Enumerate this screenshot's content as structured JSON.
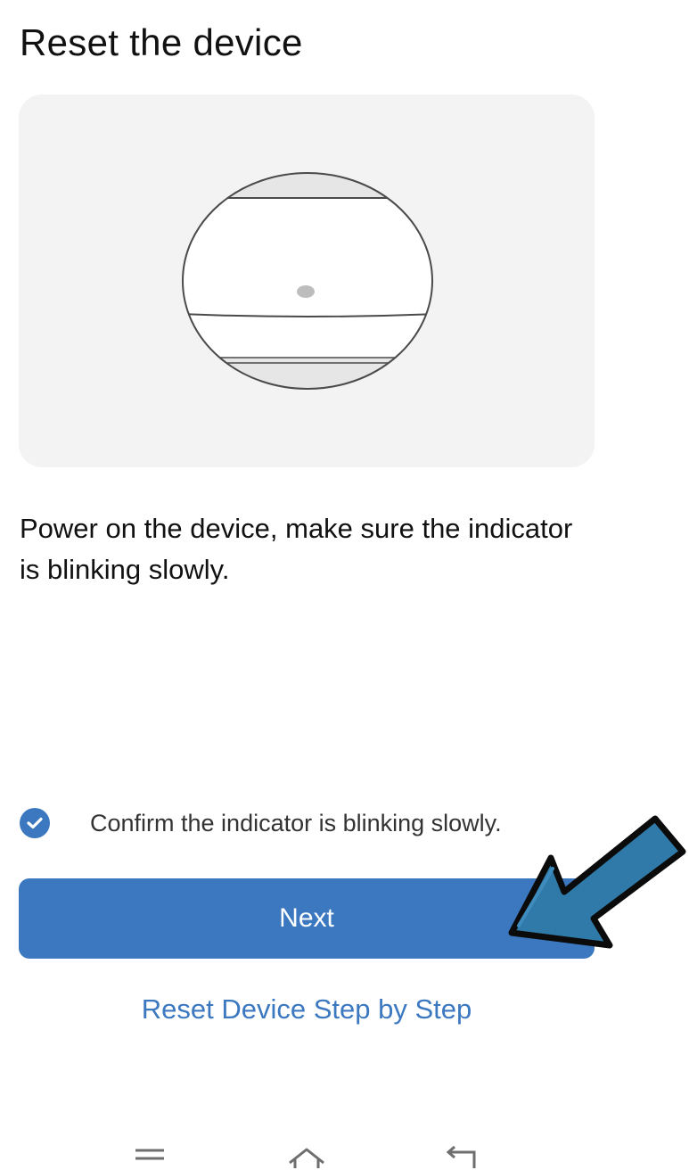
{
  "header": {
    "title": "Reset the device"
  },
  "illustration": {
    "icon": "device-indicator-illustration",
    "background": "#f3f3f3"
  },
  "instructions": {
    "text": "Power on the device, make sure the indicator is blinking slowly."
  },
  "confirm": {
    "label": "Confirm the indicator is blinking slowly.",
    "checked": true,
    "color": "#3b78c0"
  },
  "actions": {
    "next_label": "Next",
    "reset_link_label": "Reset Device Step by Step",
    "accent": "#3b78c0"
  },
  "annotation": {
    "icon": "pointer-arrow-icon",
    "color": "#2f7aa8"
  },
  "system_nav": {
    "items": [
      "menu-icon",
      "home-icon",
      "back-icon"
    ]
  }
}
